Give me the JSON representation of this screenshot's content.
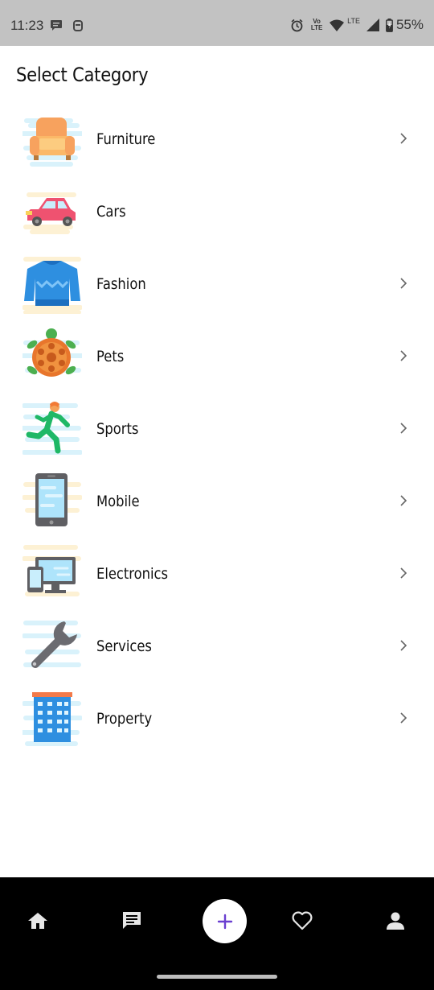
{
  "status_bar": {
    "time": "11:23",
    "battery": "55%",
    "network_label": "LTE",
    "volte_label": "Vo LTE",
    "icons": [
      "message-icon",
      "app-notification-icon",
      "alarm-icon",
      "volte-icon",
      "wifi-icon",
      "signal-icon",
      "battery-icon"
    ]
  },
  "header": {
    "title": "Select Category"
  },
  "categories": [
    {
      "label": "Furniture",
      "icon": "armchair-icon",
      "has_chevron": true
    },
    {
      "label": "Cars",
      "icon": "car-icon",
      "has_chevron": false
    },
    {
      "label": "Fashion",
      "icon": "sweater-icon",
      "has_chevron": true
    },
    {
      "label": "Pets",
      "icon": "turtle-icon",
      "has_chevron": true
    },
    {
      "label": "Sports",
      "icon": "runner-icon",
      "has_chevron": true
    },
    {
      "label": "Mobile",
      "icon": "smartphone-icon",
      "has_chevron": true
    },
    {
      "label": "Electronics",
      "icon": "devices-icon",
      "has_chevron": true
    },
    {
      "label": "Services",
      "icon": "wrench-icon",
      "has_chevron": true
    },
    {
      "label": "Property",
      "icon": "building-icon",
      "has_chevron": true
    }
  ],
  "bottom_nav": {
    "items": [
      "home-icon",
      "chat-icon",
      "add-icon",
      "heart-icon",
      "profile-icon"
    ],
    "fab_color": "#6a3fd0"
  },
  "colors": {
    "status_bar_bg": "#c2c2c2",
    "nav_bg": "#000000",
    "accent": "#6a3fd0"
  }
}
